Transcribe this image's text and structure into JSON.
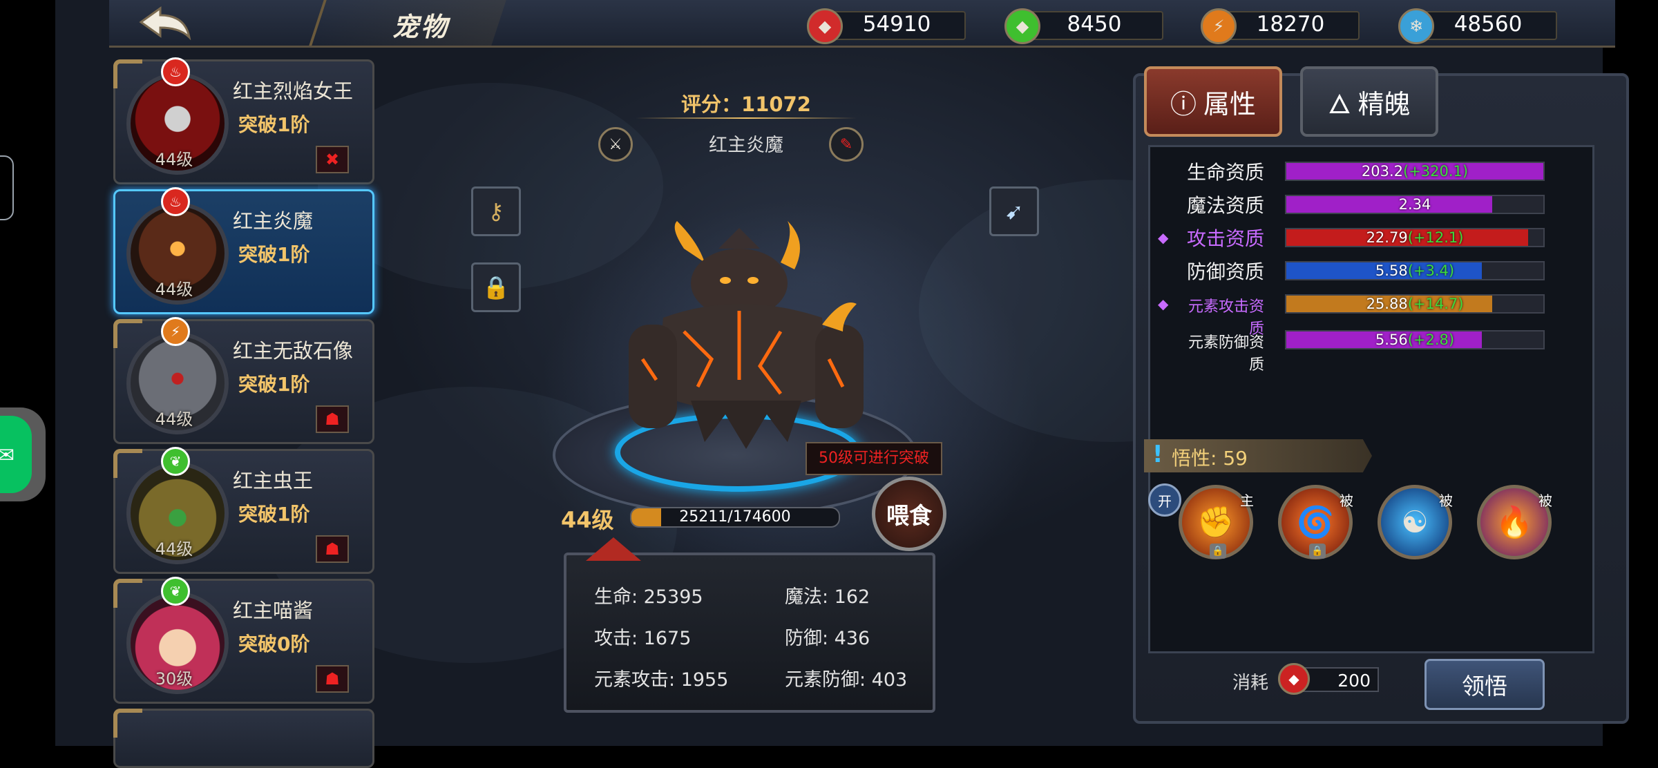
{
  "header": {
    "title": "宠物",
    "resources": [
      {
        "icon": "red-gem-icon",
        "value": "54910",
        "color": "#d12b2b"
      },
      {
        "icon": "green-gem-icon",
        "value": "8450",
        "color": "#3fbf2f"
      },
      {
        "icon": "lightning-coin-icon",
        "value": "18270",
        "color": "#e07a1c"
      },
      {
        "icon": "ice-crystal-icon",
        "value": "48560",
        "color": "#3aa0d8"
      }
    ]
  },
  "pets": [
    {
      "name": "红主烈焰女王",
      "breakthrough": "突破1阶",
      "level": "44级",
      "element": "火",
      "elem_color": "#d9281f",
      "selected": false
    },
    {
      "name": "红主炎魔",
      "breakthrough": "突破1阶",
      "level": "44级",
      "element": "火",
      "elem_color": "#d9281f",
      "selected": true
    },
    {
      "name": "红主无敌石像",
      "breakthrough": "突破1阶",
      "level": "44级",
      "element": "雷",
      "elem_color": "#e07a1c",
      "selected": false
    },
    {
      "name": "红主虫王",
      "breakthrough": "突破1阶",
      "level": "44级",
      "element": "木",
      "elem_color": "#3fbf2f",
      "selected": false
    },
    {
      "name": "红主喵酱",
      "breakthrough": "突破0阶",
      "level": "30级",
      "element": "木",
      "elem_color": "#3fbf2f",
      "selected": false
    }
  ],
  "center": {
    "score": "评分：11072",
    "pet_name": "红主炎魔",
    "breakthrough_hint": "50级可进行突破",
    "feed_label": "喂食",
    "level": "44级",
    "exp_text": "25211/174600",
    "exp_fraction": 0.1444
  },
  "stats": {
    "hp": "生命: 25395",
    "mp": "魔法: 162",
    "atk": "攻击: 1675",
    "def": "防御: 436",
    "elem_atk": "元素攻击: 1955",
    "elem_def": "元素防御: 403"
  },
  "panel": {
    "tab_attr": "属性",
    "tab_spirit": "精魄",
    "attributes": [
      {
        "label": "生命资质",
        "value": "203.2",
        "bonus": "(+320.1)",
        "fill": 1.0,
        "color": "#a020c8",
        "highlight": false
      },
      {
        "label": "魔法资质",
        "value": "2.34",
        "bonus": "",
        "fill": 0.8,
        "color": "#a020c8",
        "highlight": false
      },
      {
        "label": "攻击资质",
        "value": "22.79",
        "bonus": "(+12.1)",
        "fill": 0.94,
        "color": "#c41c1c",
        "highlight": true
      },
      {
        "label": "防御资质",
        "value": "5.58",
        "bonus": "(+3.4)",
        "fill": 0.76,
        "color": "#1e54c8",
        "highlight": false
      },
      {
        "label": "元素攻击资质",
        "value": "25.88",
        "bonus": "(+14.7)",
        "fill": 0.8,
        "color": "#c27a1e",
        "highlight": true
      },
      {
        "label": "元素防御资质",
        "value": "5.56",
        "bonus": "(+2.8)",
        "fill": 0.76,
        "color": "#a020c8",
        "highlight": false
      }
    ],
    "wisdom": "悟性: 59",
    "open_badge": "开",
    "skills": [
      {
        "tag": "主",
        "icon": "fire-fist-icon",
        "locked": true
      },
      {
        "tag": "被",
        "icon": "flame-swirl-icon",
        "locked": true
      },
      {
        "tag": "被",
        "icon": "meditation-icon",
        "locked": false
      },
      {
        "tag": "被",
        "icon": "flame-icon",
        "locked": false
      }
    ],
    "cost_label": "消耗",
    "cost_value": "200",
    "comprehend_label": "领悟"
  }
}
